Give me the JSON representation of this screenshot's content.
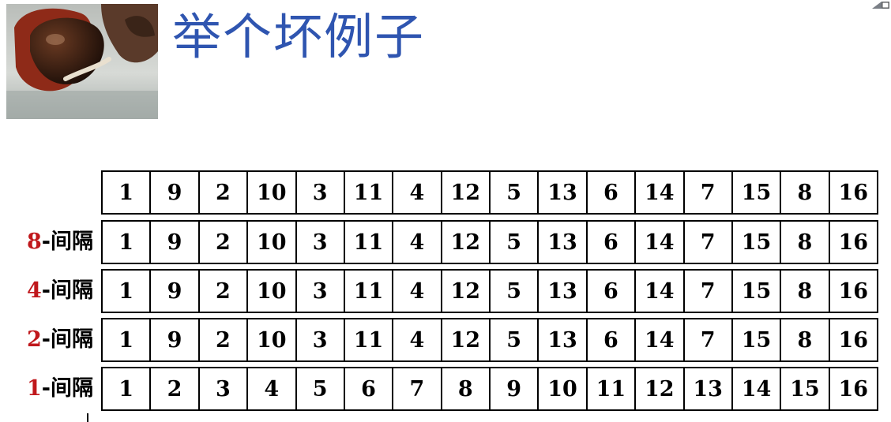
{
  "slide": {
    "title": "举个坏例子",
    "photo_icon": "chestnut-photo",
    "rows": [
      {
        "label_num": "",
        "label_text": "",
        "cells": [
          "1",
          "9",
          "2",
          "10",
          "3",
          "11",
          "4",
          "12",
          "5",
          "13",
          "6",
          "14",
          "7",
          "15",
          "8",
          "16"
        ]
      },
      {
        "label_num": "8",
        "label_text": "-间隔",
        "cells": [
          "1",
          "9",
          "2",
          "10",
          "3",
          "11",
          "4",
          "12",
          "5",
          "13",
          "6",
          "14",
          "7",
          "15",
          "8",
          "16"
        ]
      },
      {
        "label_num": "4",
        "label_text": "-间隔",
        "cells": [
          "1",
          "9",
          "2",
          "10",
          "3",
          "11",
          "4",
          "12",
          "5",
          "13",
          "6",
          "14",
          "7",
          "15",
          "8",
          "16"
        ]
      },
      {
        "label_num": "2",
        "label_text": "-间隔",
        "cells": [
          "1",
          "9",
          "2",
          "10",
          "3",
          "11",
          "4",
          "12",
          "5",
          "13",
          "6",
          "14",
          "7",
          "15",
          "8",
          "16"
        ]
      },
      {
        "label_num": "1",
        "label_text": "-间隔",
        "cells": [
          "1",
          "2",
          "3",
          "4",
          "5",
          "6",
          "7",
          "8",
          "9",
          "10",
          "11",
          "12",
          "13",
          "14",
          "15",
          "16"
        ]
      }
    ]
  },
  "colors": {
    "title": "#2f55b0",
    "gap_number": "#c0181c",
    "grid": "#000000"
  }
}
